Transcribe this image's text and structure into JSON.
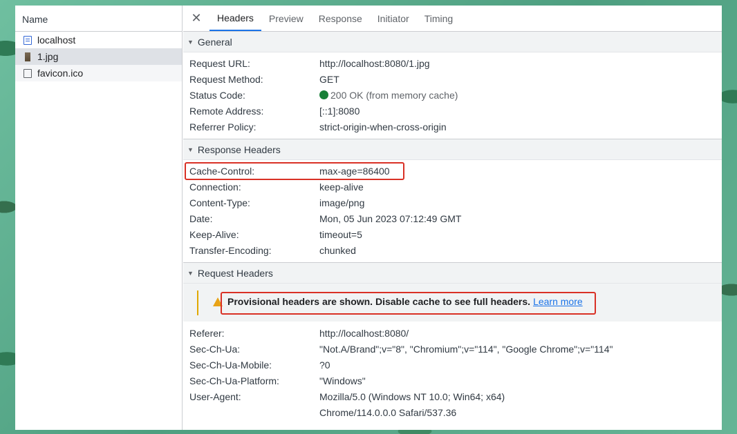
{
  "list": {
    "header": "Name",
    "items": [
      {
        "name": "localhost",
        "icon": "document-icon"
      },
      {
        "name": "1.jpg",
        "icon": "image-icon"
      },
      {
        "name": "favicon.ico",
        "icon": "blank-file-icon"
      }
    ]
  },
  "tabs": [
    "Headers",
    "Preview",
    "Response",
    "Initiator",
    "Timing"
  ],
  "general": {
    "title": "General",
    "rows": [
      {
        "key": "Request URL:",
        "value": "http://localhost:8080/1.jpg"
      },
      {
        "key": "Request Method:",
        "value": "GET"
      },
      {
        "key": "Status Code:",
        "value": "200 OK",
        "extra": "(from memory cache)"
      },
      {
        "key": "Remote Address:",
        "value": "[::1]:8080"
      },
      {
        "key": "Referrer Policy:",
        "value": "strict-origin-when-cross-origin"
      }
    ]
  },
  "response_headers": {
    "title": "Response Headers",
    "rows": [
      {
        "key": "Cache-Control:",
        "value": "max-age=86400"
      },
      {
        "key": "Connection:",
        "value": "keep-alive"
      },
      {
        "key": "Content-Type:",
        "value": "image/png"
      },
      {
        "key": "Date:",
        "value": "Mon, 05 Jun 2023 07:12:49 GMT"
      },
      {
        "key": "Keep-Alive:",
        "value": "timeout=5"
      },
      {
        "key": "Transfer-Encoding:",
        "value": "chunked"
      }
    ]
  },
  "request_headers": {
    "title": "Request Headers",
    "warning": "Provisional headers are shown. Disable cache to see full headers.",
    "learn_more": "Learn more",
    "rows": [
      {
        "key": "Referer:",
        "value": "http://localhost:8080/"
      },
      {
        "key": "Sec-Ch-Ua:",
        "value": "\"Not.A/Brand\";v=\"8\", \"Chromium\";v=\"114\", \"Google Chrome\";v=\"114\""
      },
      {
        "key": "Sec-Ch-Ua-Mobile:",
        "value": "?0"
      },
      {
        "key": "Sec-Ch-Ua-Platform:",
        "value": "\"Windows\""
      },
      {
        "key": "User-Agent:",
        "value": "Mozilla/5.0 (Windows NT 10.0; Win64; x64)"
      },
      {
        "key": "",
        "value": "Chrome/114.0.0.0 Safari/537.36"
      }
    ]
  },
  "colors": {
    "status_ok": "#188038",
    "highlight": "#d93025",
    "tab_accent": "#1a73e8",
    "warning": "#e8a317"
  }
}
